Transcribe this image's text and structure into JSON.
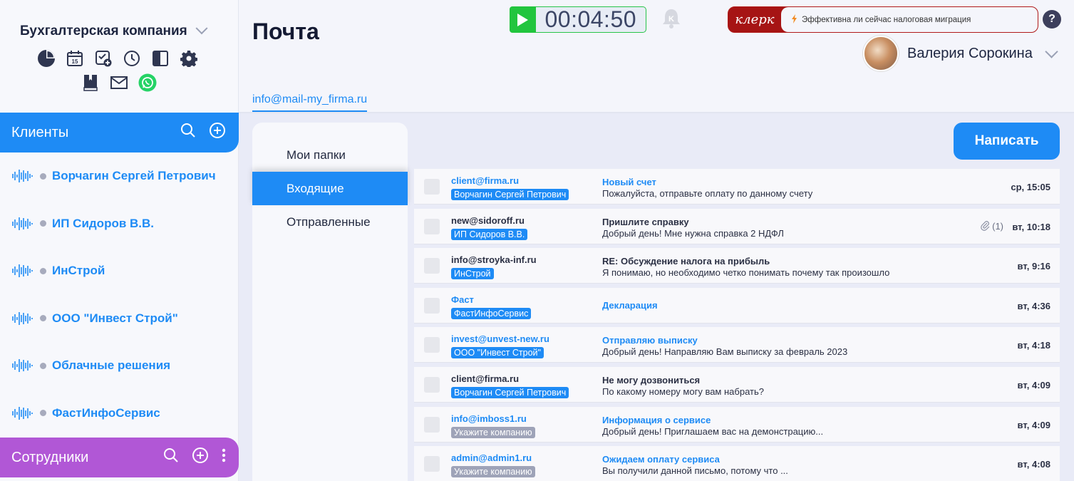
{
  "company": {
    "name": "Бухгалтерская компания"
  },
  "toolbar": {
    "icons": [
      "pie-chart-icon",
      "calendar-icon",
      "task-add-icon",
      "clock-icon",
      "layout-icon",
      "gear-icon",
      "book-icon",
      "mail-icon",
      "whatsapp-icon"
    ],
    "calendar_day": "15"
  },
  "clients": {
    "title": "Клиенты",
    "items": [
      "Ворчагин Сергей Петрович",
      "ИП Сидоров В.В.",
      "ИнСтрой",
      "ООО \"Инвест Строй\"",
      "Облачные решения",
      "ФастИнфоСервис"
    ]
  },
  "staff": {
    "title": "Сотрудники"
  },
  "header": {
    "page_title": "Почта",
    "timer": "00:04:50",
    "klerk_logo": "клерк",
    "klerk_news": "Эффективна ли сейчас налоговая миграция",
    "help": "?",
    "user_name": "Валерия Сорокина"
  },
  "mailbox": {
    "address": "info@mail-my_firma.ru"
  },
  "folders": [
    "Мои папки",
    "Входящие",
    "Отправленные"
  ],
  "active_folder": "Входящие",
  "compose_label": "Написать",
  "emails": [
    {
      "from": "client@firma.ru",
      "tag": "Ворчагин Сергей Петрович",
      "subject": "Новый счет",
      "preview": "Пожалуйста, отправьте оплату по данному счету",
      "date": "ср, 15:05",
      "unread": true,
      "tag_gray": false
    },
    {
      "from": "new@sidoroff.ru",
      "tag": "ИП Сидоров В.В.",
      "subject": "Пришлите справку",
      "preview": "Добрый день! Мне нужна справка 2 НДФЛ",
      "date": "вт, 10:18",
      "unread": false,
      "tag_gray": false,
      "attachments": "(1)"
    },
    {
      "from": "info@stroyka-inf.ru",
      "tag": "ИнСтрой",
      "subject": "RE: Обсуждение налога на прибыль",
      "preview": "Я понимаю, но необходимо четко понимать почему так произошло",
      "date": "вт, 9:16",
      "unread": false,
      "tag_gray": false
    },
    {
      "from": "Фаст",
      "tag": "ФастИнфоСервис",
      "subject": "Декларация",
      "preview": "",
      "date": "вт, 4:36",
      "unread": true,
      "tag_gray": false
    },
    {
      "from": "invest@unvest-new.ru",
      "tag": "ООО \"Инвест Строй\"",
      "subject": "Отправляю выписку",
      "preview": "Добрый день! Направляю Вам выписку за февраль 2023",
      "date": "вт, 4:18",
      "unread": true,
      "tag_gray": false
    },
    {
      "from": "client@firma.ru",
      "tag": "Ворчагин Сергей Петрович",
      "subject": "Не могу дозвониться",
      "preview": "По какому номеру могу вам набрать?",
      "date": "вт, 4:09",
      "unread": false,
      "tag_gray": false
    },
    {
      "from": "info@imboss1.ru",
      "tag": "Укажите компанию",
      "subject": "Информация о сервисе",
      "preview": "Добрый день! Приглашаем вас на демонстрацию...",
      "date": "вт, 4:09",
      "unread": true,
      "tag_gray": true
    },
    {
      "from": "admin@admin1.ru",
      "tag": "Укажите компанию",
      "subject": "Ожидаем оплату сервиса",
      "preview": "Вы получили данной письмо, потому что ...",
      "date": "вт, 4:08",
      "unread": true,
      "tag_gray": true
    }
  ]
}
